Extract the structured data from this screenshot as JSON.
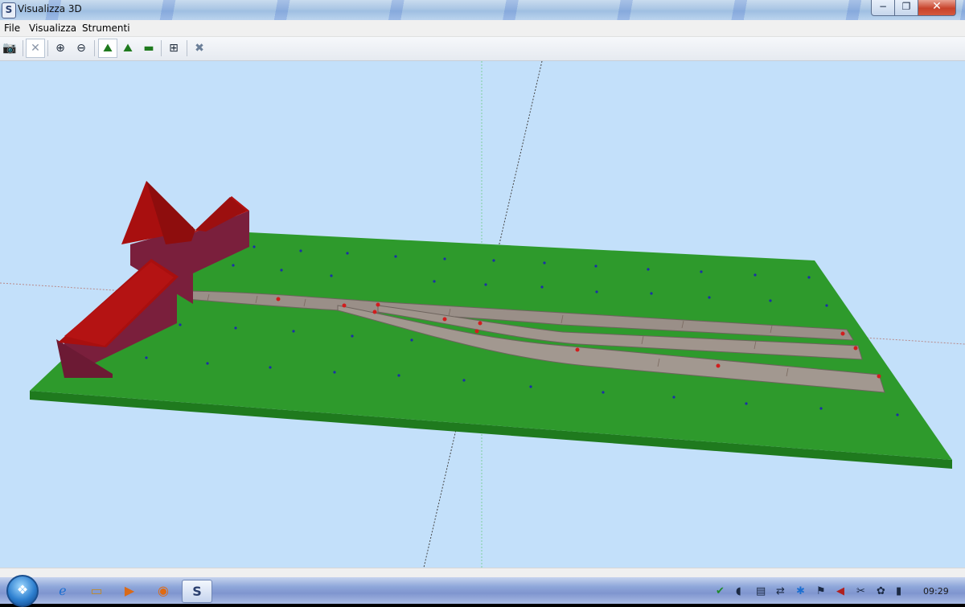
{
  "window": {
    "title": "Visualizza 3D",
    "app_icon": "s-logo-icon",
    "minimize": "−",
    "maximize": "❐",
    "close": "✕"
  },
  "menu": [
    "File",
    "Visualizza",
    "Strumenti"
  ],
  "toolbar": [
    {
      "name": "camera-icon",
      "glyph": "📷"
    },
    {
      "name": "cross-arrows-icon",
      "glyph": "✕"
    },
    {
      "name": "zoom-in-icon",
      "glyph": "⊕"
    },
    {
      "name": "zoom-out-icon",
      "glyph": "⊖"
    },
    {
      "name": "terrain-view-icon",
      "glyph": "⛰"
    },
    {
      "name": "terrain-outline-icon",
      "glyph": "⛰"
    },
    {
      "name": "flat-view-icon",
      "glyph": "▬"
    },
    {
      "name": "fit-view-icon",
      "glyph": "⊞"
    },
    {
      "name": "tools-icon",
      "glyph": "✖"
    }
  ],
  "scene": {
    "ground_color": "#2e9a2c",
    "ground_edge_color": "#1f7a1e",
    "sky_color": "#c3e0fa",
    "building_roof_color": "#a80f0f",
    "building_wall_color": "#7a1f3c",
    "track_color": "#9a8f88"
  },
  "taskbar": {
    "start_icon": "windows-start-icon",
    "buttons": [
      "internet-explorer-icon",
      "folder-icon",
      "media-player-icon",
      "firefox-icon",
      "app-s-icon"
    ],
    "clock": "09:29"
  }
}
